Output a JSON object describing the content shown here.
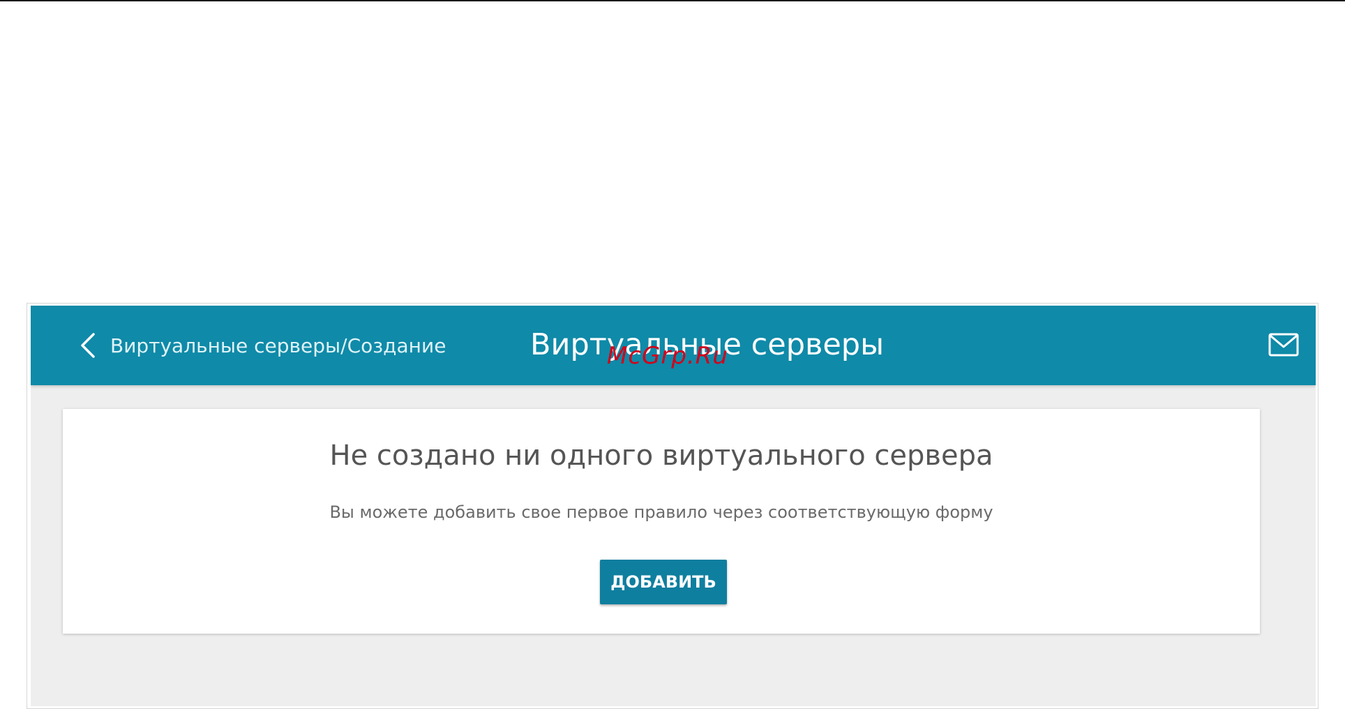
{
  "header": {
    "back_label": "Виртуальные серверы/Создание",
    "title": "Виртуальные серверы",
    "back_icon": "chevron-left-icon",
    "mail_icon": "mail-icon"
  },
  "watermark": "McGrp.Ru",
  "empty_state": {
    "title": "Не создано ни одного виртуального сервера",
    "description": "Вы можете добавить свое первое правило через соответствующую форму",
    "add_button_label": "ДОБАВИТЬ"
  },
  "colors": {
    "header_bg": "#0f8aa8",
    "button_bg": "#0f7f9f",
    "page_bg": "#eeeeee",
    "watermark": "#d0021b"
  }
}
